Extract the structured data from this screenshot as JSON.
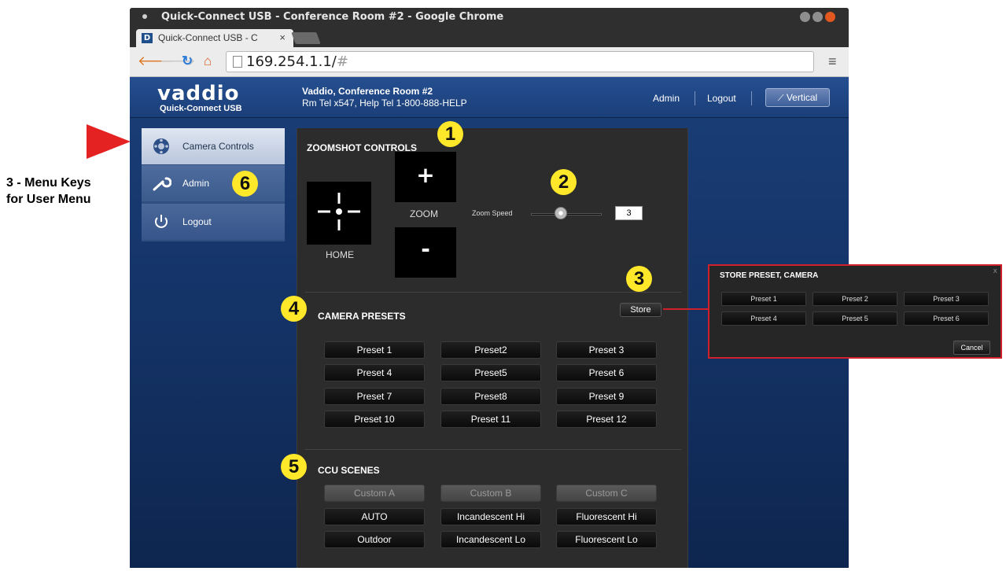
{
  "window": {
    "title": "Quick-Connect USB - Conference Room #2 - Google Chrome",
    "tab_label": "Quick-Connect USB - C",
    "tab_close": "×",
    "favicon": "D",
    "url_host": "169.254.1.1/",
    "url_hash": "#"
  },
  "header": {
    "logo": "vaddio",
    "logo_sub": "Quick-Connect USB",
    "room_name": "Vaddio, Conference Room #2",
    "room_tel": "Rm Tel x547, Help Tel 1-800-888-HELP",
    "admin_link": "Admin",
    "logout_link": "Logout",
    "vertical_button": "Vertical",
    "vertical_icon": "vertical-signal-icon"
  },
  "sidebar": {
    "items": [
      {
        "label": "Camera Controls",
        "icon": "camera-gear-icon"
      },
      {
        "label": "Admin",
        "icon": "wrench-icon"
      },
      {
        "label": "Logout",
        "icon": "power-icon"
      }
    ]
  },
  "zoomshot": {
    "title": "ZOOMSHOT CONTROLS",
    "home_label": "HOME",
    "zoom_label": "ZOOM",
    "zoom_in": "+",
    "zoom_out": "-",
    "zoom_speed_label": "Zoom Speed",
    "zoom_speed_value": "3"
  },
  "presets": {
    "title": "CAMERA PRESETS",
    "store_label": "Store",
    "buttons": [
      "Preset 1",
      "Preset2",
      "Preset 3",
      "Preset 4",
      "Preset5",
      "Preset 6",
      "Preset 7",
      "Preset8",
      "Preset 9",
      "Preset 10",
      "Preset 11",
      "Preset 12"
    ]
  },
  "ccu": {
    "title": "CCU SCENES",
    "buttons": [
      "Custom A",
      "Custom B",
      "Custom C",
      "AUTO",
      "Incandescent Hi",
      "Fluorescent Hi",
      "Outdoor",
      "Incandescent Lo",
      "Fluorescent Lo"
    ]
  },
  "store_popup": {
    "title": "STORE PRESET, CAMERA",
    "close": "x",
    "buttons": [
      "Preset 1",
      "Preset 2",
      "Preset 3",
      "Preset 4",
      "Preset 5",
      "Preset 6"
    ],
    "cancel": "Cancel"
  },
  "annotations": {
    "badges": [
      "1",
      "2",
      "3",
      "4",
      "5",
      "6"
    ],
    "menu_keys_line1": "3 - Menu Keys",
    "menu_keys_line2": "for User Menu",
    "badge_color": "#ffe82a",
    "arrow_color": "#e52222"
  }
}
